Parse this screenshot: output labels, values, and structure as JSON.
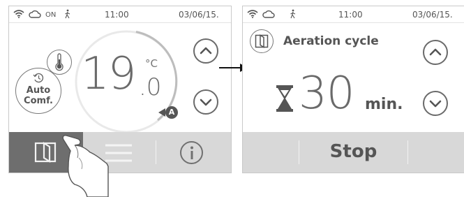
{
  "screen1": {
    "status": {
      "on": "ON",
      "time": "11:00",
      "date": "03/06/15."
    },
    "temperature": {
      "integer": "19",
      "decimal": ".0",
      "unit": "°C"
    },
    "mode": {
      "line1": "Auto",
      "line2": "Comf."
    },
    "badge": "A",
    "icons": [
      "wifi-icon",
      "cloud-icon",
      "presence-icon",
      "thermometer-icon",
      "clock-icon",
      "window-icon",
      "menu-icon",
      "info-icon",
      "chevron-up-icon",
      "chevron-down-icon"
    ]
  },
  "screen2": {
    "status": {
      "time": "11:00",
      "date": "03/06/15."
    },
    "title": "Aeration cycle",
    "value": "30",
    "unit": "min.",
    "stop_label": "Stop",
    "icons": [
      "wifi-icon",
      "cloud-icon",
      "presence-icon",
      "window-icon",
      "hourglass-icon",
      "chevron-up-icon",
      "chevron-down-icon"
    ]
  },
  "colors": {
    "text": "#555555",
    "bar": "#d8d8d8",
    "active": "#6e6e6e",
    "ring": "#e6e6e6",
    "ring_active": "#b0b0b0"
  }
}
